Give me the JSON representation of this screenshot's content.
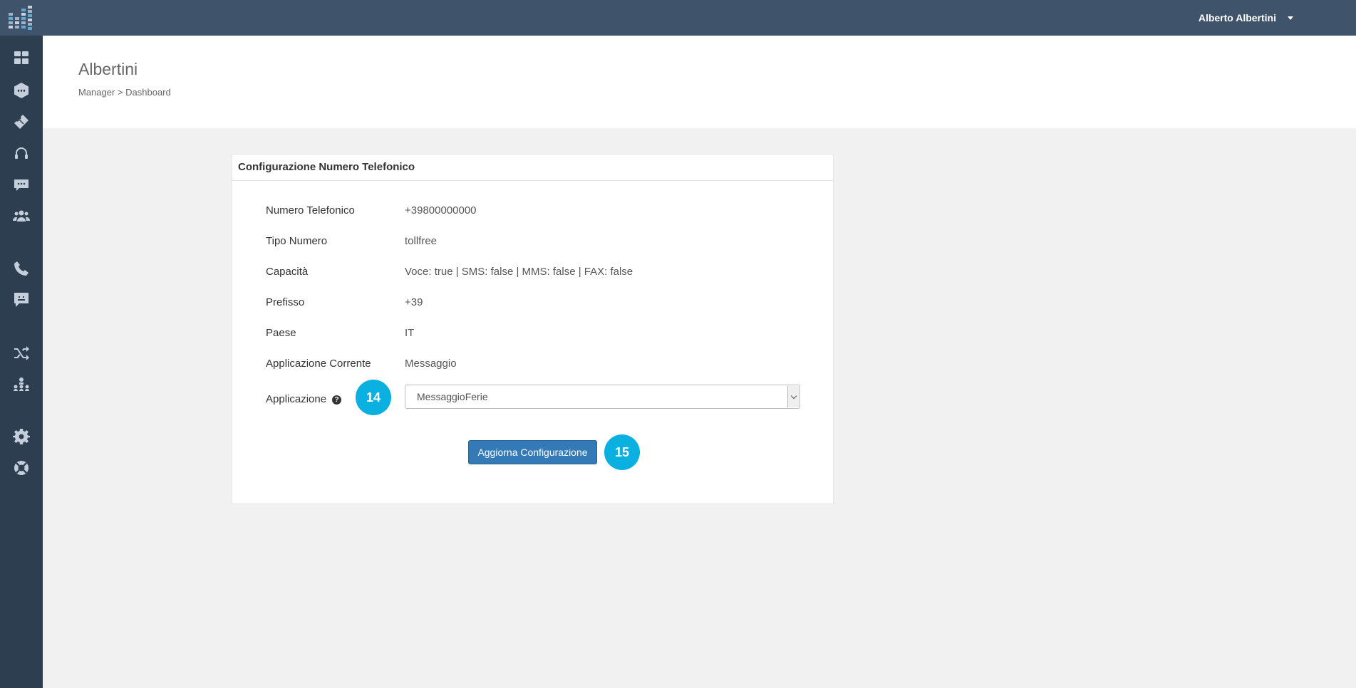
{
  "topbar": {
    "user_name": "Alberto Albertini",
    "logo_icon": "grid-bars-logo",
    "user_caret_icon": "caret-down-icon"
  },
  "sidebar": {
    "icons": [
      "dashboard-icon",
      "hexagon-chat-icon",
      "ticket-icon",
      "headset-icon",
      "chat-bubble-icon",
      "users-group-icon",
      "phone-icon",
      "message-icon",
      "shuffle-icon",
      "sitemap-icon",
      "gear-icon",
      "lifebuoy-icon"
    ]
  },
  "header": {
    "title": "Albertini",
    "breadcrumb_root": "Manager",
    "breadcrumb_sep": " > ",
    "breadcrumb_current": "Dashboard"
  },
  "card": {
    "title": "Configurazione Numero Telefonico",
    "fields": [
      {
        "label": "Numero Telefonico",
        "value": "+39800000000"
      },
      {
        "label": "Tipo Numero",
        "value": "tollfree"
      },
      {
        "label": "Capacità",
        "value": "Voce: true | SMS: false | MMS: false | FAX: false"
      },
      {
        "label": "Prefisso",
        "value": "+39"
      },
      {
        "label": "Paese",
        "value": "IT"
      },
      {
        "label": "Applicazione Corrente",
        "value": "Messaggio"
      }
    ],
    "application_label": "Applicazione",
    "application_help_icon": "question-circle-icon",
    "application_selected": "MessaggioFerie",
    "submit_label": "Aggiorna Configurazione"
  },
  "badges": {
    "select_step": "14",
    "button_step": "15",
    "color": "#0ab0e0"
  },
  "colors": {
    "topbar": "#3f546a",
    "sidebar": "#2c3e50",
    "button": "#337ab7"
  }
}
